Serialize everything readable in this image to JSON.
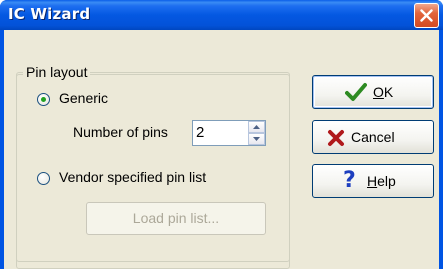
{
  "window": {
    "title": "IC Wizard"
  },
  "pin_layout": {
    "group_label": "Pin layout",
    "generic_label": "Generic",
    "generic_selected": true,
    "number_of_pins_label": "Number of pins",
    "number_of_pins_value": "2",
    "vendor_label": "Vendor specified pin list",
    "vendor_selected": false,
    "load_button_label": "Load pin list..."
  },
  "buttons": {
    "ok": {
      "label": "OK",
      "accel": "O"
    },
    "cancel": {
      "label": "Cancel"
    },
    "help": {
      "label": "Help",
      "accel": "H"
    }
  },
  "colors": {
    "title_bar": "#0054e3",
    "dialog_bg": "#ece9d8",
    "close_button": "#d44a22",
    "ok_check": "#2e8b22",
    "cancel_x": "#b0191c",
    "help_question": "#1e3fbf"
  },
  "icons": {
    "ok": "checkmark-icon",
    "cancel": "red-x-icon",
    "help": "question-mark-icon",
    "close": "close-icon"
  }
}
